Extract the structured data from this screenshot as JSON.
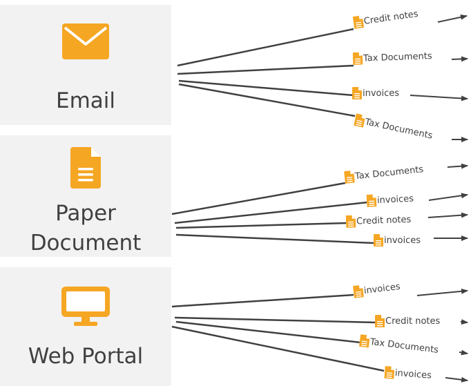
{
  "sources": {
    "email": {
      "label": "Email",
      "icon": "envelope-icon"
    },
    "paper": {
      "label_line1": "Paper",
      "label_line2": "Document",
      "icon": "document-icon"
    },
    "web": {
      "label": "Web Portal",
      "icon": "monitor-icon"
    }
  },
  "flows": {
    "email": [
      "Credit notes",
      "Tax Documents",
      "invoices",
      "Tax Documents"
    ],
    "paper": [
      "Tax Documents",
      "invoices",
      "Credit notes",
      "invoices"
    ],
    "web": [
      "invoices",
      "Credit notes",
      "Tax Documents",
      "invoices"
    ]
  },
  "colors": {
    "accent": "#f5a623",
    "box_background": "#f2f2f2",
    "line": "#404040",
    "text": "#404040"
  }
}
